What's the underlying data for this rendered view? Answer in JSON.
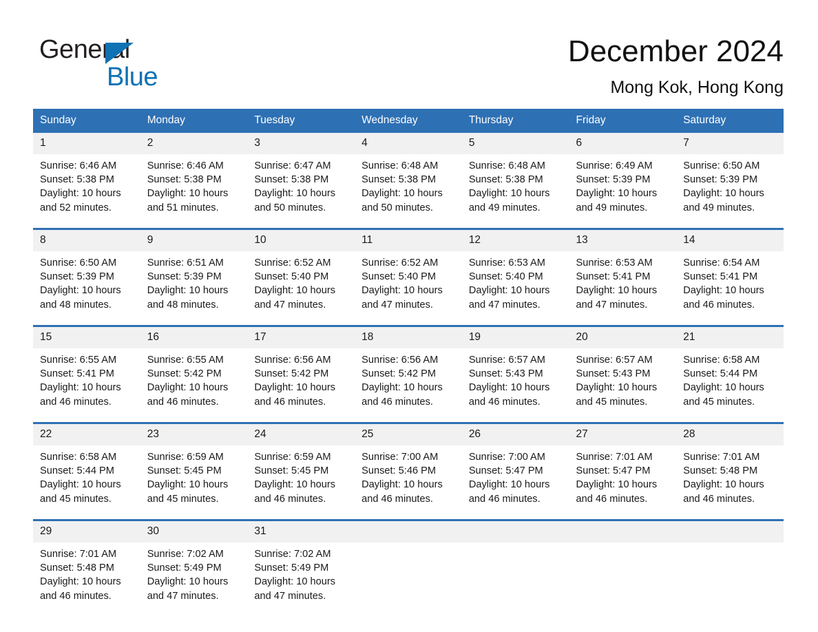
{
  "brand": {
    "name_part1": "General",
    "name_part2": "Blue",
    "logo_icon": "triangle-icon"
  },
  "header": {
    "title": "December 2024",
    "subtitle": "Mong Kok, Hong Kong"
  },
  "colors": {
    "header_blue": "#2e70b4",
    "brand_blue": "#0e72b5",
    "daynum_band": "#f1f1f1",
    "text": "#1a1a1a"
  },
  "weekday_headers": [
    "Sunday",
    "Monday",
    "Tuesday",
    "Wednesday",
    "Thursday",
    "Friday",
    "Saturday"
  ],
  "weeks": [
    [
      {
        "day": "1",
        "sunrise": "Sunrise: 6:46 AM",
        "sunset": "Sunset: 5:38 PM",
        "daylight1": "Daylight: 10 hours",
        "daylight2": "and 52 minutes."
      },
      {
        "day": "2",
        "sunrise": "Sunrise: 6:46 AM",
        "sunset": "Sunset: 5:38 PM",
        "daylight1": "Daylight: 10 hours",
        "daylight2": "and 51 minutes."
      },
      {
        "day": "3",
        "sunrise": "Sunrise: 6:47 AM",
        "sunset": "Sunset: 5:38 PM",
        "daylight1": "Daylight: 10 hours",
        "daylight2": "and 50 minutes."
      },
      {
        "day": "4",
        "sunrise": "Sunrise: 6:48 AM",
        "sunset": "Sunset: 5:38 PM",
        "daylight1": "Daylight: 10 hours",
        "daylight2": "and 50 minutes."
      },
      {
        "day": "5",
        "sunrise": "Sunrise: 6:48 AM",
        "sunset": "Sunset: 5:38 PM",
        "daylight1": "Daylight: 10 hours",
        "daylight2": "and 49 minutes."
      },
      {
        "day": "6",
        "sunrise": "Sunrise: 6:49 AM",
        "sunset": "Sunset: 5:39 PM",
        "daylight1": "Daylight: 10 hours",
        "daylight2": "and 49 minutes."
      },
      {
        "day": "7",
        "sunrise": "Sunrise: 6:50 AM",
        "sunset": "Sunset: 5:39 PM",
        "daylight1": "Daylight: 10 hours",
        "daylight2": "and 49 minutes."
      }
    ],
    [
      {
        "day": "8",
        "sunrise": "Sunrise: 6:50 AM",
        "sunset": "Sunset: 5:39 PM",
        "daylight1": "Daylight: 10 hours",
        "daylight2": "and 48 minutes."
      },
      {
        "day": "9",
        "sunrise": "Sunrise: 6:51 AM",
        "sunset": "Sunset: 5:39 PM",
        "daylight1": "Daylight: 10 hours",
        "daylight2": "and 48 minutes."
      },
      {
        "day": "10",
        "sunrise": "Sunrise: 6:52 AM",
        "sunset": "Sunset: 5:40 PM",
        "daylight1": "Daylight: 10 hours",
        "daylight2": "and 47 minutes."
      },
      {
        "day": "11",
        "sunrise": "Sunrise: 6:52 AM",
        "sunset": "Sunset: 5:40 PM",
        "daylight1": "Daylight: 10 hours",
        "daylight2": "and 47 minutes."
      },
      {
        "day": "12",
        "sunrise": "Sunrise: 6:53 AM",
        "sunset": "Sunset: 5:40 PM",
        "daylight1": "Daylight: 10 hours",
        "daylight2": "and 47 minutes."
      },
      {
        "day": "13",
        "sunrise": "Sunrise: 6:53 AM",
        "sunset": "Sunset: 5:41 PM",
        "daylight1": "Daylight: 10 hours",
        "daylight2": "and 47 minutes."
      },
      {
        "day": "14",
        "sunrise": "Sunrise: 6:54 AM",
        "sunset": "Sunset: 5:41 PM",
        "daylight1": "Daylight: 10 hours",
        "daylight2": "and 46 minutes."
      }
    ],
    [
      {
        "day": "15",
        "sunrise": "Sunrise: 6:55 AM",
        "sunset": "Sunset: 5:41 PM",
        "daylight1": "Daylight: 10 hours",
        "daylight2": "and 46 minutes."
      },
      {
        "day": "16",
        "sunrise": "Sunrise: 6:55 AM",
        "sunset": "Sunset: 5:42 PM",
        "daylight1": "Daylight: 10 hours",
        "daylight2": "and 46 minutes."
      },
      {
        "day": "17",
        "sunrise": "Sunrise: 6:56 AM",
        "sunset": "Sunset: 5:42 PM",
        "daylight1": "Daylight: 10 hours",
        "daylight2": "and 46 minutes."
      },
      {
        "day": "18",
        "sunrise": "Sunrise: 6:56 AM",
        "sunset": "Sunset: 5:42 PM",
        "daylight1": "Daylight: 10 hours",
        "daylight2": "and 46 minutes."
      },
      {
        "day": "19",
        "sunrise": "Sunrise: 6:57 AM",
        "sunset": "Sunset: 5:43 PM",
        "daylight1": "Daylight: 10 hours",
        "daylight2": "and 46 minutes."
      },
      {
        "day": "20",
        "sunrise": "Sunrise: 6:57 AM",
        "sunset": "Sunset: 5:43 PM",
        "daylight1": "Daylight: 10 hours",
        "daylight2": "and 45 minutes."
      },
      {
        "day": "21",
        "sunrise": "Sunrise: 6:58 AM",
        "sunset": "Sunset: 5:44 PM",
        "daylight1": "Daylight: 10 hours",
        "daylight2": "and 45 minutes."
      }
    ],
    [
      {
        "day": "22",
        "sunrise": "Sunrise: 6:58 AM",
        "sunset": "Sunset: 5:44 PM",
        "daylight1": "Daylight: 10 hours",
        "daylight2": "and 45 minutes."
      },
      {
        "day": "23",
        "sunrise": "Sunrise: 6:59 AM",
        "sunset": "Sunset: 5:45 PM",
        "daylight1": "Daylight: 10 hours",
        "daylight2": "and 45 minutes."
      },
      {
        "day": "24",
        "sunrise": "Sunrise: 6:59 AM",
        "sunset": "Sunset: 5:45 PM",
        "daylight1": "Daylight: 10 hours",
        "daylight2": "and 46 minutes."
      },
      {
        "day": "25",
        "sunrise": "Sunrise: 7:00 AM",
        "sunset": "Sunset: 5:46 PM",
        "daylight1": "Daylight: 10 hours",
        "daylight2": "and 46 minutes."
      },
      {
        "day": "26",
        "sunrise": "Sunrise: 7:00 AM",
        "sunset": "Sunset: 5:47 PM",
        "daylight1": "Daylight: 10 hours",
        "daylight2": "and 46 minutes."
      },
      {
        "day": "27",
        "sunrise": "Sunrise: 7:01 AM",
        "sunset": "Sunset: 5:47 PM",
        "daylight1": "Daylight: 10 hours",
        "daylight2": "and 46 minutes."
      },
      {
        "day": "28",
        "sunrise": "Sunrise: 7:01 AM",
        "sunset": "Sunset: 5:48 PM",
        "daylight1": "Daylight: 10 hours",
        "daylight2": "and 46 minutes."
      }
    ],
    [
      {
        "day": "29",
        "sunrise": "Sunrise: 7:01 AM",
        "sunset": "Sunset: 5:48 PM",
        "daylight1": "Daylight: 10 hours",
        "daylight2": "and 46 minutes."
      },
      {
        "day": "30",
        "sunrise": "Sunrise: 7:02 AM",
        "sunset": "Sunset: 5:49 PM",
        "daylight1": "Daylight: 10 hours",
        "daylight2": "and 47 minutes."
      },
      {
        "day": "31",
        "sunrise": "Sunrise: 7:02 AM",
        "sunset": "Sunset: 5:49 PM",
        "daylight1": "Daylight: 10 hours",
        "daylight2": "and 47 minutes."
      },
      {
        "day": "",
        "sunrise": "",
        "sunset": "",
        "daylight1": "",
        "daylight2": ""
      },
      {
        "day": "",
        "sunrise": "",
        "sunset": "",
        "daylight1": "",
        "daylight2": ""
      },
      {
        "day": "",
        "sunrise": "",
        "sunset": "",
        "daylight1": "",
        "daylight2": ""
      },
      {
        "day": "",
        "sunrise": "",
        "sunset": "",
        "daylight1": "",
        "daylight2": ""
      }
    ]
  ]
}
